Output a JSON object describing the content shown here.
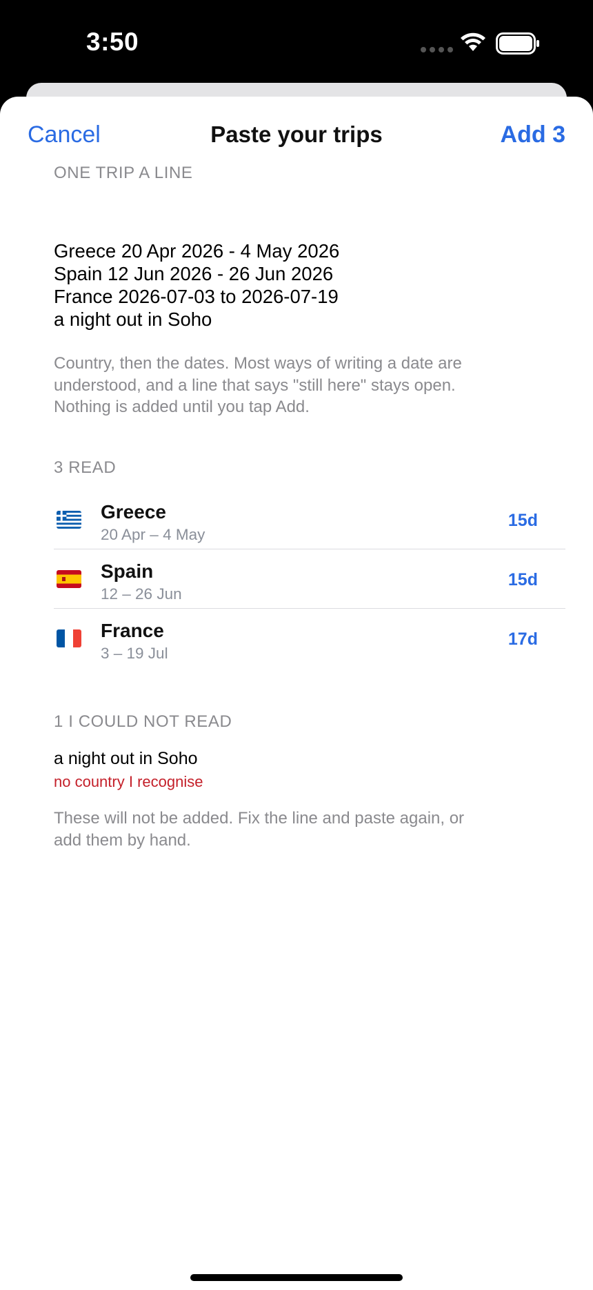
{
  "status": {
    "time": "3:50"
  },
  "nav": {
    "cancel_label": "Cancel",
    "title": "Paste your trips",
    "add_label": "Add 3"
  },
  "input_section": {
    "header": "ONE TRIP A LINE",
    "lines": [
      "Greece 20 Apr 2026 - 4 May 2026",
      "Spain 12 Jun 2026 - 26 Jun 2026",
      "France 2026-07-03 to 2026-07-19",
      "a night out in Soho"
    ],
    "help_lines": [
      "Country, then the dates. Most ways of writing a date are",
      "understood, and a line that says \"still here\" stays open.",
      "Nothing is added until you tap Add."
    ]
  },
  "read_section": {
    "header": "3 READ",
    "trips": [
      {
        "name": "Greece",
        "dates": "20 Apr – 4 May",
        "days": "15d",
        "flag": "greece-flag-icon"
      },
      {
        "name": "Spain",
        "dates": "12 – 26 Jun",
        "days": "15d",
        "flag": "spain-flag-icon"
      },
      {
        "name": "France",
        "dates": "3 – 19 Jul",
        "days": "17d",
        "flag": "france-flag-icon"
      }
    ]
  },
  "failed_section": {
    "header": "1 I COULD NOT READ",
    "line": "a night out in Soho",
    "reason": "no country I recognise",
    "help_lines": [
      "These will not be added. Fix the line and paste again, or",
      "add them by hand."
    ]
  },
  "colors": {
    "accent": "#2a6be3",
    "error": "#c4202a",
    "secondary": "#8a8a8e"
  }
}
